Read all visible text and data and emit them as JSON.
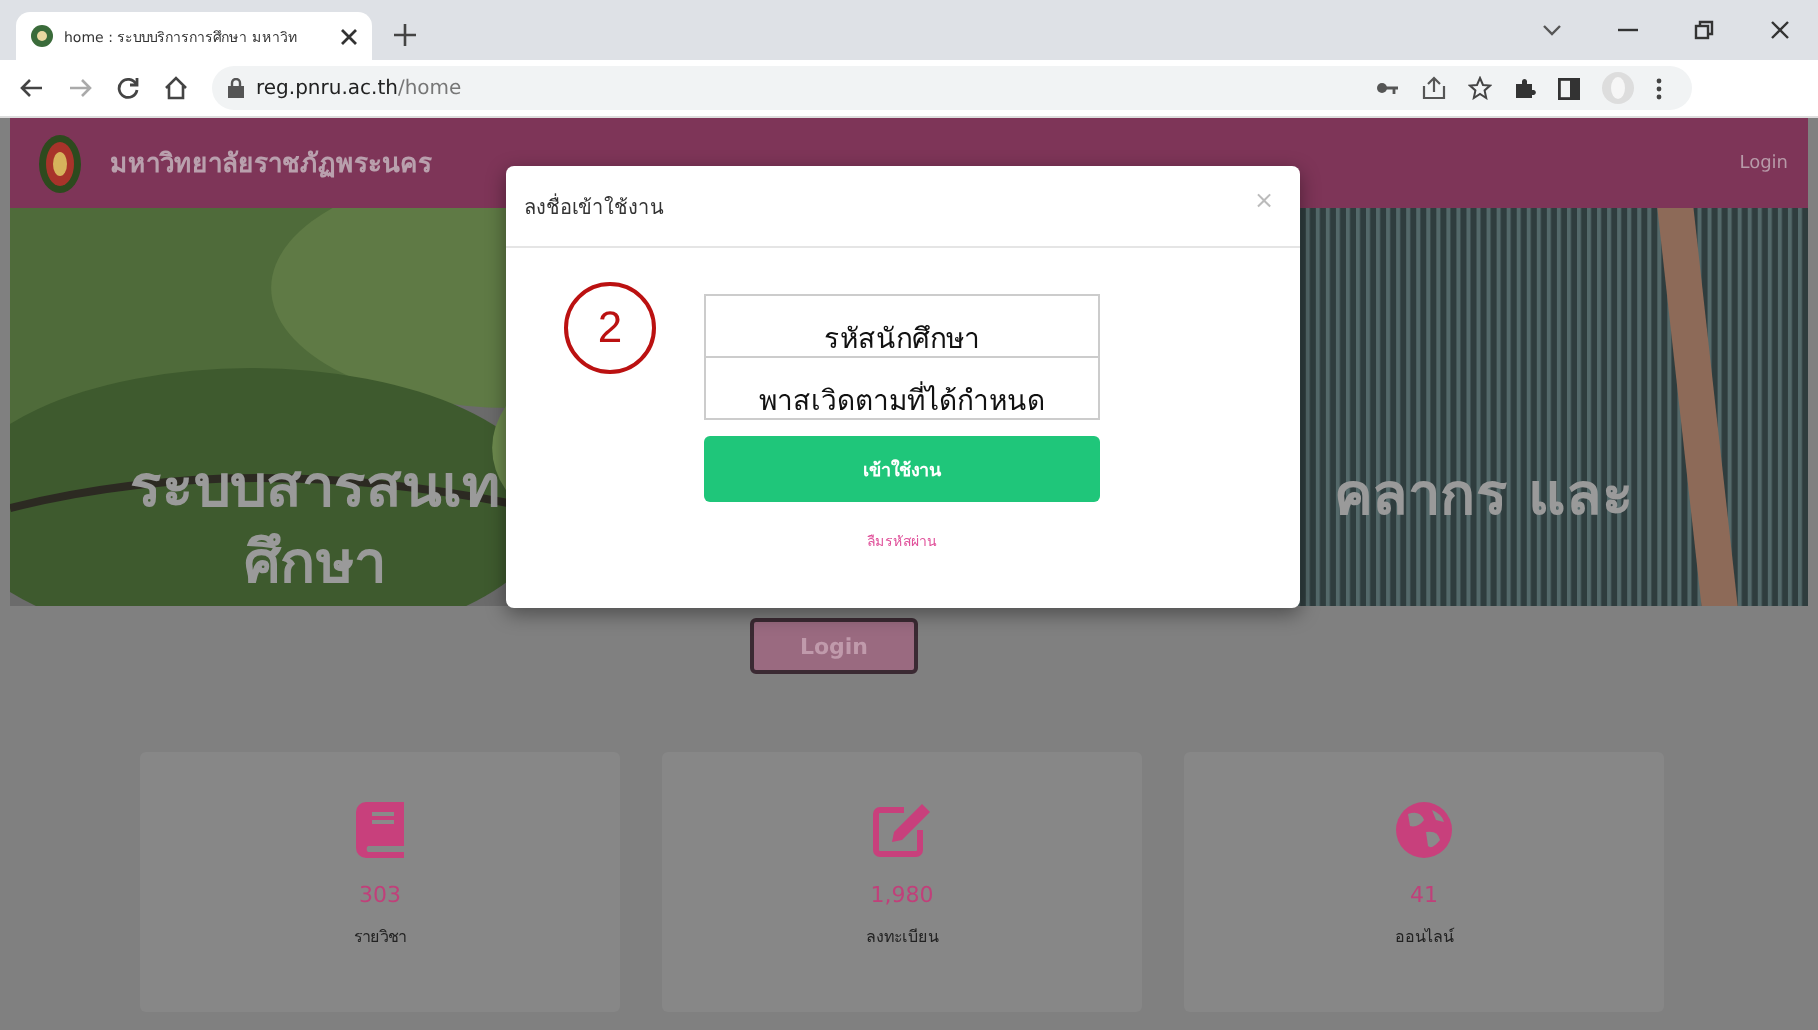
{
  "browser": {
    "tab": {
      "title": "home : ระบบบริการการศึกษา มหาวิท",
      "selected": true
    },
    "url": {
      "domain": "reg.pnru.ac.th",
      "path": "/home"
    }
  },
  "header": {
    "site_name": "มหาวิทยาลัยราชภัฏพระนคร",
    "login_link": "Login"
  },
  "hero": {
    "kind": "picture",
    "heading_left": [
      "ระบบสารสนเท",
      "ศึกษา"
    ],
    "heading_right": "คลากร และ"
  },
  "login_button": "Login",
  "stats": [
    {
      "kind": "book",
      "value": "303",
      "label": "รายวิชา"
    },
    {
      "kind": "edit",
      "value": "1,980",
      "label": "ลงทะเบียน"
    },
    {
      "kind": "globe",
      "value": "41",
      "label": "ออนไลน์"
    }
  ],
  "modal": {
    "title": "ลงชื่อเข้าใช้งาน",
    "close": "×",
    "step_marker": "2",
    "fields": [
      {
        "value": "รหัสนักศึกษา"
      },
      {
        "value": "พาสเวิดตามที่ได้กำหนด"
      }
    ],
    "submit": "เข้าใช้งาน",
    "forgot_link": "ลืมรหัสผ่าน"
  }
}
